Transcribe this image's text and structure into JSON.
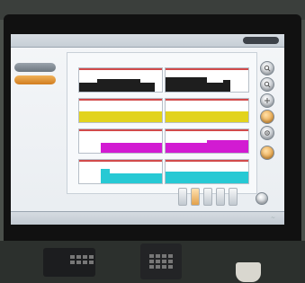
{
  "window": {
    "title": "",
    "title_pill": ""
  },
  "sidebar": {
    "items": [
      {
        "label": "",
        "style": "gray"
      },
      {
        "label": "",
        "style": "orange"
      }
    ]
  },
  "header": {
    "labels": [
      "",
      "",
      ""
    ]
  },
  "charts": [
    {
      "id": "top-left",
      "color": "#1e1e1e"
    },
    {
      "id": "top-right",
      "color": "#1e1e1e"
    },
    {
      "id": "yellow-left",
      "color": "#e2d31d"
    },
    {
      "id": "yellow-right",
      "color": "#e2d31d"
    },
    {
      "id": "magenta-left",
      "color": "#d21bd2"
    },
    {
      "id": "magenta-right",
      "color": "#d21bd2"
    },
    {
      "id": "cyan-left",
      "color": "#27c9d4"
    },
    {
      "id": "cyan-right",
      "color": "#27c9d4"
    }
  ],
  "right_controls": [
    {
      "name": "control-1",
      "style": "gray"
    },
    {
      "name": "control-2",
      "style": "gray"
    },
    {
      "name": "control-3",
      "style": "gray"
    },
    {
      "name": "control-4",
      "style": "orange"
    },
    {
      "name": "control-5",
      "style": "gray"
    },
    {
      "name": "control-6",
      "style": "orange"
    }
  ],
  "bottom_buttons": [
    {
      "name": "mini-1",
      "style": "gray"
    },
    {
      "name": "mini-2",
      "style": "orange"
    },
    {
      "name": "mini-3",
      "style": "gray"
    },
    {
      "name": "mini-4",
      "style": "gray"
    },
    {
      "name": "mini-5",
      "style": "gray"
    }
  ],
  "status_bar": {
    "text": ""
  }
}
